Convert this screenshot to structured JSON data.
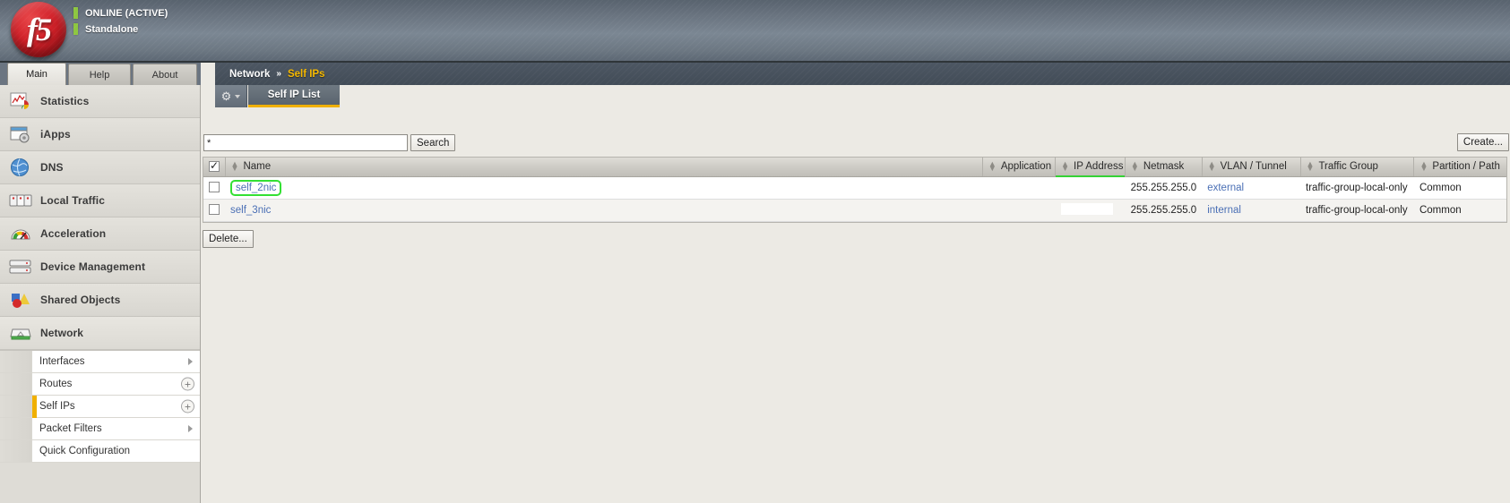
{
  "header": {
    "logo_text": "f5",
    "status_primary": "ONLINE (ACTIVE)",
    "status_secondary": "Standalone"
  },
  "nav_tabs": [
    {
      "label": "Main",
      "active": true
    },
    {
      "label": "Help",
      "active": false
    },
    {
      "label": "About",
      "active": false
    }
  ],
  "sidebar": {
    "items": [
      {
        "label": "Statistics",
        "icon": "statistics-icon"
      },
      {
        "label": "iApps",
        "icon": "iapps-icon"
      },
      {
        "label": "DNS",
        "icon": "dns-globe-icon"
      },
      {
        "label": "Local Traffic",
        "icon": "local-traffic-icon"
      },
      {
        "label": "Acceleration",
        "icon": "acceleration-gauge-icon"
      },
      {
        "label": "Device Management",
        "icon": "device-management-icon"
      },
      {
        "label": "Shared Objects",
        "icon": "shared-objects-icon"
      },
      {
        "label": "Network",
        "icon": "network-icon"
      }
    ],
    "submenu": [
      {
        "label": "Interfaces",
        "affordance": "arrow",
        "selected": false
      },
      {
        "label": "Routes",
        "affordance": "plus",
        "selected": false
      },
      {
        "label": "Self IPs",
        "affordance": "plus",
        "selected": true
      },
      {
        "label": "Packet Filters",
        "affordance": "arrow",
        "selected": false
      },
      {
        "label": "Quick Configuration",
        "affordance": "none",
        "selected": false
      }
    ]
  },
  "breadcrumb": {
    "root": "Network",
    "separator": "»",
    "current": "Self IPs"
  },
  "tabstrip": {
    "gear_icon": "gear-icon",
    "page_tab_label": "Self IP List"
  },
  "toolbar": {
    "search_value": "*",
    "search_placeholder": "",
    "search_label": "Search",
    "create_label": "Create...",
    "delete_label": "Delete..."
  },
  "table": {
    "columns": [
      {
        "key": "check",
        "label": ""
      },
      {
        "key": "name",
        "label": "Name"
      },
      {
        "key": "application",
        "label": "Application"
      },
      {
        "key": "ip_address",
        "label": "IP Address"
      },
      {
        "key": "netmask",
        "label": "Netmask"
      },
      {
        "key": "vlan_tunnel",
        "label": "VLAN / Tunnel"
      },
      {
        "key": "traffic_group",
        "label": "Traffic Group"
      },
      {
        "key": "partition_path",
        "label": "Partition / Path"
      }
    ],
    "header_checkbox_checked": true,
    "rows": [
      {
        "checked": false,
        "name": "self_2nic",
        "name_highlighted": true,
        "application": "",
        "ip_address": "",
        "netmask": "255.255.255.0",
        "vlan_tunnel": "external",
        "traffic_group": "traffic-group-local-only",
        "partition_path": "Common"
      },
      {
        "checked": false,
        "name": "self_3nic",
        "name_highlighted": false,
        "application": "",
        "ip_address": "",
        "netmask": "255.255.255.0",
        "vlan_tunnel": "internal",
        "traffic_group": "traffic-group-local-only",
        "partition_path": "Common"
      }
    ]
  },
  "colors": {
    "accent_yellow": "#f0b000",
    "status_green": "#8dc63f",
    "highlight_green": "#33e033",
    "link_blue": "#4a6fb5",
    "header_slate": "#6b7581",
    "page_bg": "#eceae4"
  }
}
